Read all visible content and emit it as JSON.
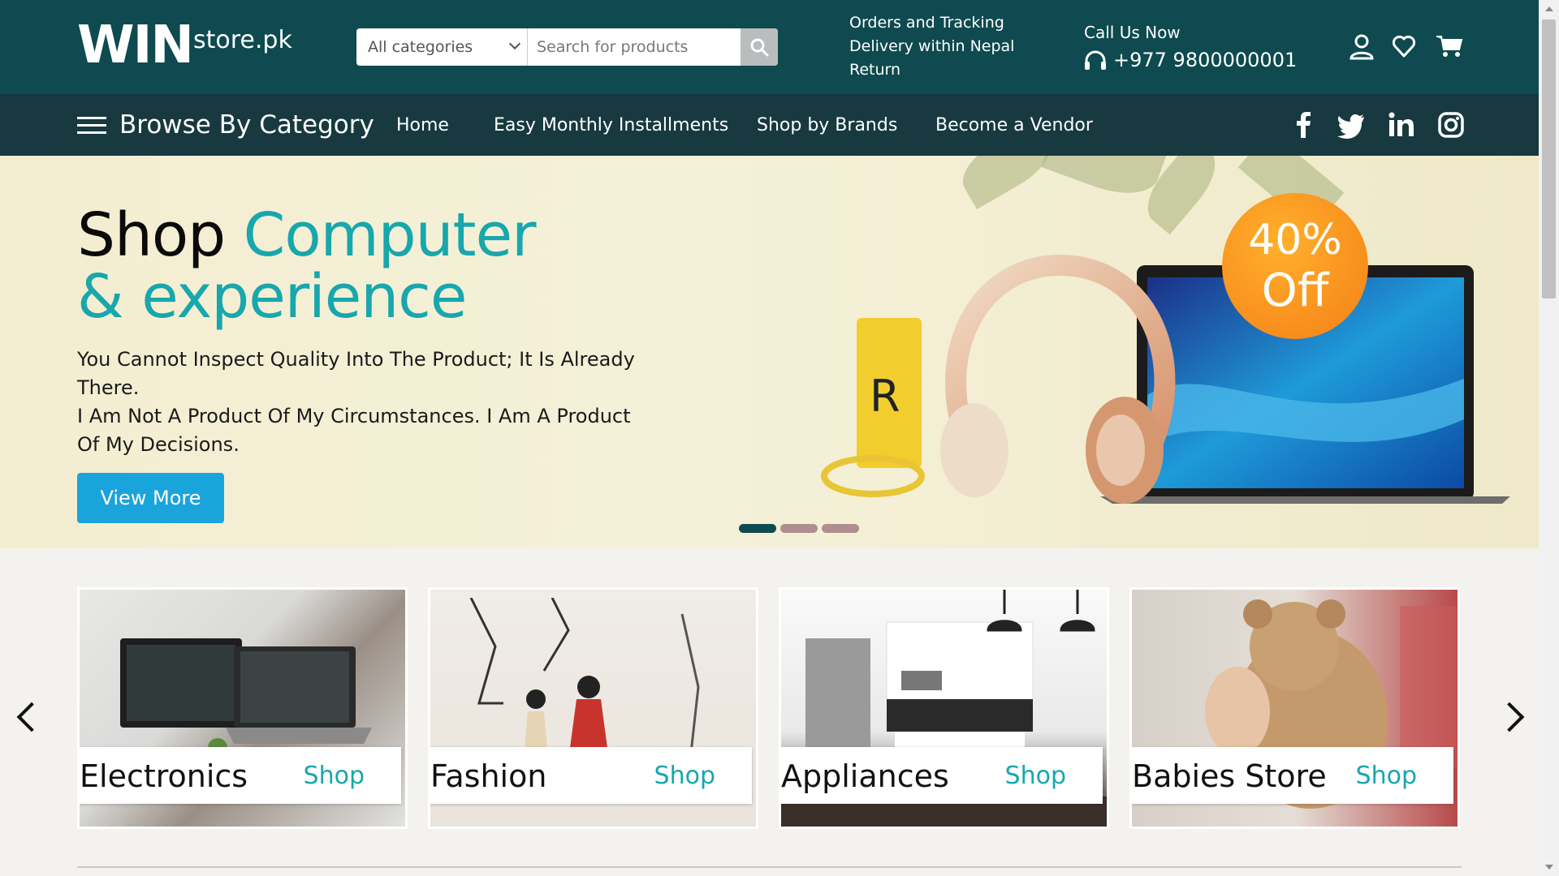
{
  "header": {
    "logo_mark": "WIN",
    "logo_text": "store.pk",
    "category_select": "All categories",
    "search_placeholder": "Search for products",
    "info_lines": [
      "Orders and Tracking",
      "Delivery within Nepal",
      "Return"
    ],
    "call_label": "Call Us Now",
    "phone": "+977 9800000001"
  },
  "nav": {
    "browse_label": "Browse By Category",
    "links": [
      "Home",
      "Easy Monthly Installments",
      "Shop by Brands",
      "Become a Vendor"
    ],
    "social": [
      "facebook-icon",
      "twitter-icon",
      "linkedin-icon",
      "instagram-icon"
    ]
  },
  "hero": {
    "title_dark": "Shop",
    "title_teal_1": "Computer",
    "title_teal_2": "& experience",
    "text_1": "You Cannot Inspect Quality Into The Product; It Is Already There.",
    "text_2": "I Am Not A Product Of My Circumstances. I Am A Product Of My Decisions.",
    "button": "View More",
    "badge_line1": "40%",
    "badge_line2": "Off",
    "box_letter": "R",
    "slides": 3,
    "active_slide": 1
  },
  "categories": [
    {
      "name": "Electronics",
      "cta": "Shop"
    },
    {
      "name": "Fashion",
      "cta": "Shop"
    },
    {
      "name": "Appliances",
      "cta": "Shop"
    },
    {
      "name": "Babies Store",
      "cta": "Shop"
    }
  ],
  "colors": {
    "header_bg": "#0e4a4f",
    "nav_bg": "#17393f",
    "teal_accent": "#17a7ac",
    "button_blue": "#1aa4dc",
    "badge_orange": "#f57f17"
  }
}
